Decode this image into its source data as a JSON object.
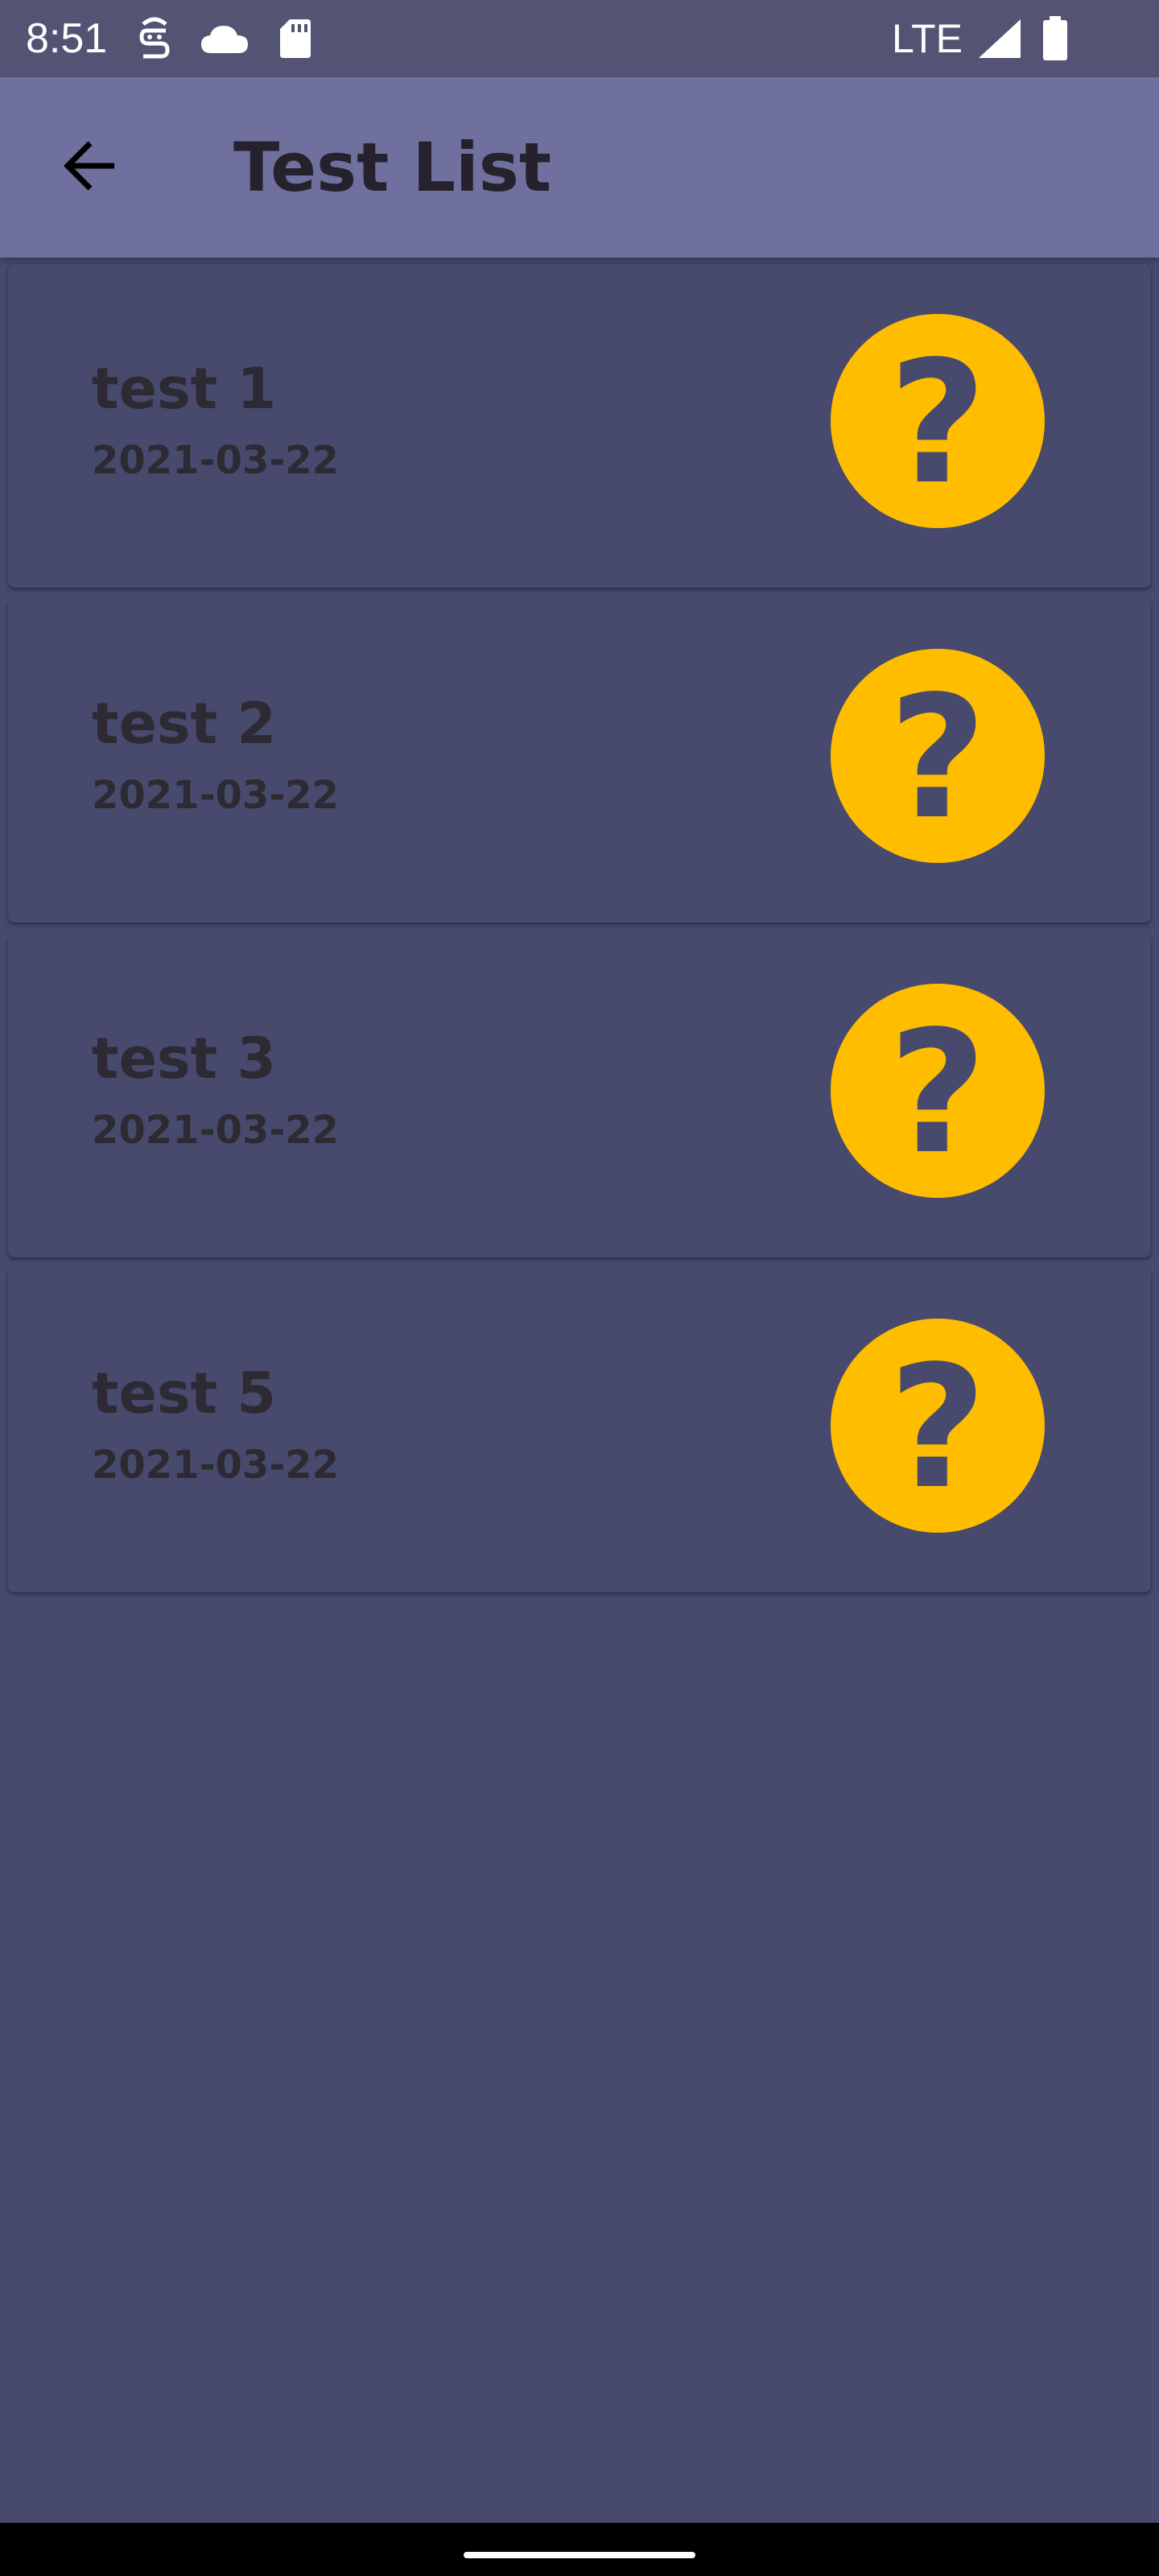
{
  "status_bar": {
    "time": "8:51",
    "network": "LTE"
  },
  "app_bar": {
    "title": "Test List",
    "back_icon": "arrow-back-icon"
  },
  "tests": [
    {
      "name": "test 1",
      "date": "2021-03-22",
      "status_icon": "question-mark-icon",
      "badge": "?"
    },
    {
      "name": "test 2",
      "date": "2021-03-22",
      "status_icon": "question-mark-icon",
      "badge": "?"
    },
    {
      "name": "test 3",
      "date": "2021-03-22",
      "status_icon": "question-mark-icon",
      "badge": "?"
    },
    {
      "name": "test 5",
      "date": "2021-03-22",
      "status_icon": "question-mark-icon",
      "badge": "?"
    }
  ],
  "colors": {
    "background": "#474a6c",
    "app_bar": "#6f709e",
    "status_bar": "#535474",
    "badge": "#ffbd00",
    "text": "#2d2a33"
  }
}
